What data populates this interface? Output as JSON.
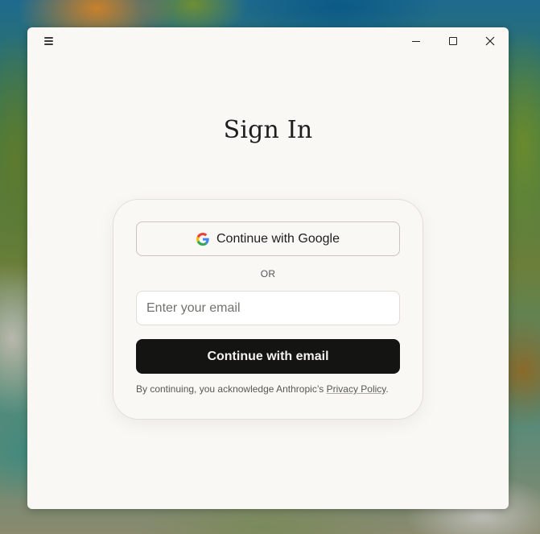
{
  "window": {
    "controls": {
      "menu_icon": "hamburger-menu-icon",
      "minimize_icon": "minimize-icon",
      "maximize_icon": "maximize-icon",
      "close_icon": "close-icon"
    }
  },
  "page": {
    "title": "Sign In"
  },
  "auth": {
    "google_button_label": "Continue with Google",
    "google_icon": "google-logo-icon",
    "divider_text": "OR",
    "email_placeholder": "Enter your email",
    "email_value": "",
    "email_button_label": "Continue with email",
    "disclaimer_prefix": "By continuing, you acknowledge Anthropic’s ",
    "privacy_link_label": "Privacy Policy",
    "disclaimer_suffix": "."
  },
  "colors": {
    "window_background": "#faf8f4",
    "primary_button": "#141413",
    "text": "#1f1e1d"
  }
}
